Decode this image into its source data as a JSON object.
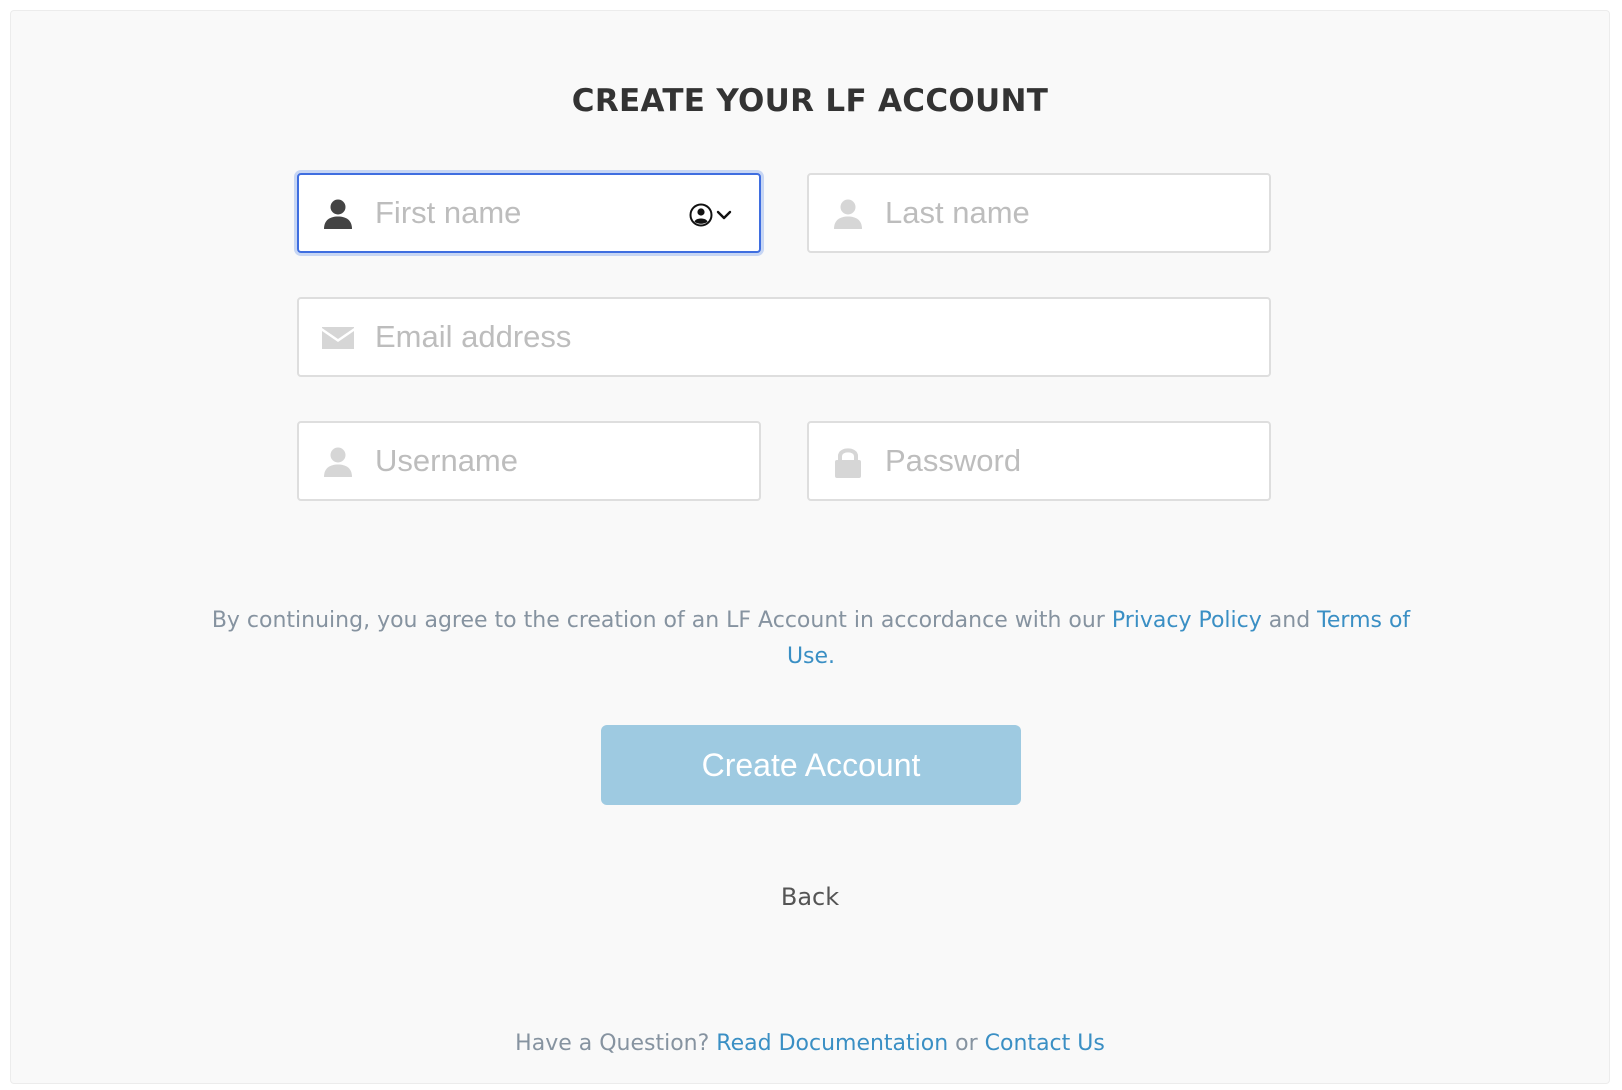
{
  "form": {
    "title": "CREATE YOUR LF ACCOUNT",
    "first_name": {
      "placeholder": "First name",
      "value": ""
    },
    "last_name": {
      "placeholder": "Last name",
      "value": ""
    },
    "email": {
      "placeholder": "Email address",
      "value": ""
    },
    "username": {
      "placeholder": "Username",
      "value": ""
    },
    "password": {
      "placeholder": "Password",
      "value": ""
    }
  },
  "legal": {
    "prefix": "By continuing, you agree to the creation of an LF Account in accordance with our ",
    "privacy_link": "Privacy Policy",
    "middle": " and ",
    "terms_link": "Terms of Use."
  },
  "actions": {
    "create_label": "Create Account",
    "back_label": "Back"
  },
  "footer": {
    "question": "Have a Question? ",
    "docs_link": "Read Documentation",
    "or": " or ",
    "contact_link": "Contact Us"
  },
  "icons": {
    "first_name": "user-icon",
    "last_name": "user-icon",
    "email": "envelope-icon",
    "username": "user-icon",
    "password": "lock-icon",
    "autofill": "contact-autofill-icon"
  },
  "colors": {
    "focus_border": "#3f6ee0",
    "link": "#3a8fc4",
    "button_bg": "#9ecae1",
    "title": "#333333",
    "muted_text": "#8693a0",
    "placeholder": "#bdbdbd"
  }
}
